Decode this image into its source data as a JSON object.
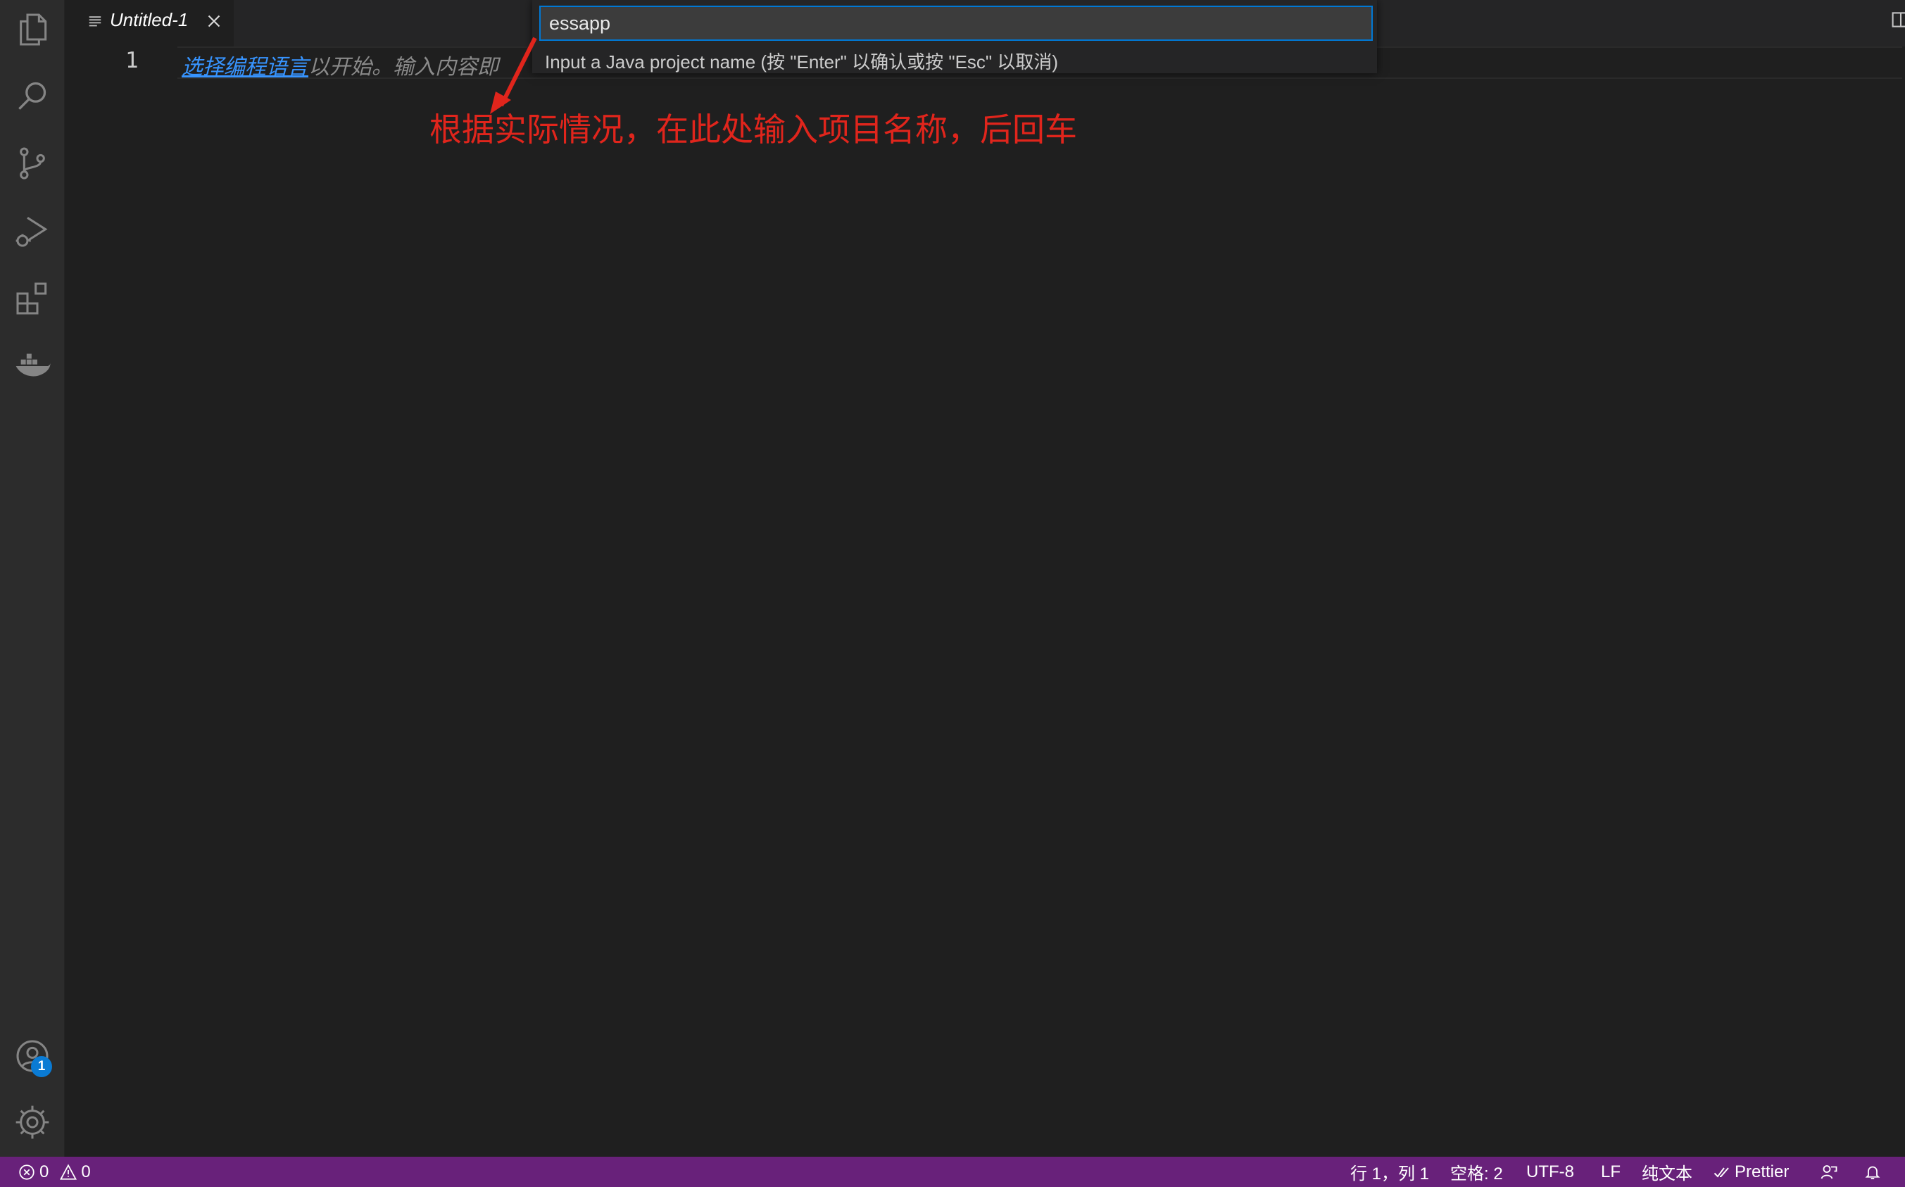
{
  "tab": {
    "title": "Untitled-1",
    "file_icon": "file-text-icon",
    "close_icon": "close-icon"
  },
  "editor_actions": {
    "split": "split-editor-icon",
    "more": "more-actions-icon"
  },
  "activity_bar": {
    "items": [
      {
        "name": "explorer-icon"
      },
      {
        "name": "search-icon"
      },
      {
        "name": "source-control-icon"
      },
      {
        "name": "run-debug-icon"
      },
      {
        "name": "extensions-icon"
      },
      {
        "name": "docker-icon"
      }
    ],
    "accounts_badge": "1",
    "accounts_icon": "account-icon",
    "settings_icon": "gear-icon"
  },
  "editor": {
    "line_number": "1",
    "hint_link": "选择编程语言",
    "hint_rest": "以开始。输入内容即"
  },
  "quick_input": {
    "value": "essapp",
    "message": "Input a Java project name (按 \"Enter\" 以确认或按 \"Esc\" 以取消)"
  },
  "annotation": {
    "text": "根据实际情况，在此处输入项目名称，后回车",
    "color": "#e0251c"
  },
  "status_bar": {
    "errors": "0",
    "warnings": "0",
    "position": "行 1，列 1",
    "indent": "空格: 2",
    "encoding": "UTF-8",
    "eol": "LF",
    "language": "纯文本",
    "formatter": "Prettier",
    "background_color": "#68217a"
  },
  "colors": {
    "accent": "#0078d4",
    "link": "#3794ff"
  }
}
